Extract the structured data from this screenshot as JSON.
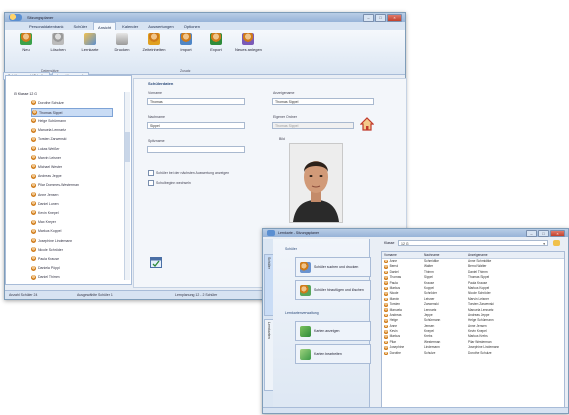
{
  "main_window": {
    "title": "Sitzungsplaner",
    "menu": [
      "Personaldatenbank",
      "Schüler",
      "Ansicht",
      "Kalender",
      "Auswertungen",
      "Optionen"
    ],
    "active_menu_index": 2,
    "ribbon_buttons": [
      "Neu",
      "Löschen",
      "Lernkarte",
      "Drucken",
      "Zeiteinheiten",
      "Import",
      "Export",
      "Neues anlegen"
    ],
    "ribbon_groups": [
      "Datensätze",
      "Zusatz"
    ],
    "tabs": [
      "Schülerauswahl Tabelle",
      "Lernaktionsmenü"
    ],
    "tree_root": "Klasse 12 G",
    "tree_items": [
      "Dorothe Schulze",
      "Thomas Sippel",
      "Helge Schürmann",
      "Manuela Lennartz",
      "Torsten Zarwenski",
      "Lukas Weißer",
      "Marvin Leisner",
      "Michael Wester",
      "Andreas Jeppe",
      "Pilar Dommes-Westerman",
      "Anne Jensen",
      "Daniel Lunen",
      "Kevin Knepel",
      "Max Kreyer",
      "Markus Koppel",
      "Josephine Lindemann",
      "Nicole Schröder",
      "Paula Krause",
      "Daniela Pöppl",
      "Daniel Thimm"
    ],
    "selected_tree_index": 1,
    "section_title": "Schülerdaten",
    "fields": {
      "vorname_label": "Vorname",
      "vorname": "Thomas",
      "nachname_label": "Nachname",
      "nachname": "Sippel",
      "spitzname_label": "Spitzname",
      "spitzname": "",
      "anzeigename_label": "Anzeigename",
      "anzeigename": "Thomas Sippel",
      "zuordnung_label": "Eigener Ordner",
      "zuordnung": "Thomas Sippel",
      "foto_label": "Bild"
    },
    "checkboxes": [
      "Schüler bei der nächsten Auswertung anzeigen",
      "Schulbeginn wechseln"
    ],
    "status": [
      "Anzahl Schüler 24",
      "Ausgewählte Schüler 1",
      "Lernplanung 12 - 2 Schüler"
    ]
  },
  "second_window": {
    "title": "Lernkarte - Sitzungsplaner",
    "section_students": "Schüler",
    "buttons": [
      "Schüler suchen und drucken",
      "Schüler hinzufügen und löschen",
      "Karten anzeigen",
      "Karten bearbeiten"
    ],
    "section_cards": "Lernkartenverwaltung",
    "vertical_tabs": [
      "Schüler",
      "Lernkarten"
    ],
    "filter_label": "Klasse",
    "filter_value": "12 G",
    "columns": [
      "Vorname",
      "Nachname",
      "Anzeigename"
    ],
    "rows": [
      [
        "Anne",
        "Schmidtke",
        "Anne Schmidtke"
      ],
      [
        "Bernd",
        "Walter",
        "Bernd Walter"
      ],
      [
        "Daniel",
        "Thimm",
        "Daniel Thimm"
      ],
      [
        "Thomas",
        "Sippel",
        "Thomas Sippel"
      ],
      [
        "Paula",
        "Krause",
        "Paula Krause"
      ],
      [
        "Markus",
        "Koppel",
        "Markus Koppel"
      ],
      [
        "Nicole",
        "Schröder",
        "Nicole Schröder"
      ],
      [
        "Marvin",
        "Leisner",
        "Marvin Leisner"
      ],
      [
        "Torsten",
        "Zarwenski",
        "Torsten Zarwenski"
      ],
      [
        "Manuela",
        "Lennartz",
        "Manuela Lennartz"
      ],
      [
        "Andreas",
        "Jeppe",
        "Andreas Jeppe"
      ],
      [
        "Helge",
        "Schürmann",
        "Helge Schürmann"
      ],
      [
        "Anne",
        "Jensen",
        "Anne Jensen"
      ],
      [
        "Kevin",
        "Knepel",
        "Kevin Knepel"
      ],
      [
        "Markus",
        "Krebs",
        "Markus Krebs"
      ],
      [
        "Pilar",
        "Westerman",
        "Pilar Westerman"
      ],
      [
        "Josephine",
        "Lindemann",
        "Josephine Lindemann"
      ],
      [
        "Dorothe",
        "Schulze",
        "Dorothe Schulze"
      ]
    ]
  }
}
